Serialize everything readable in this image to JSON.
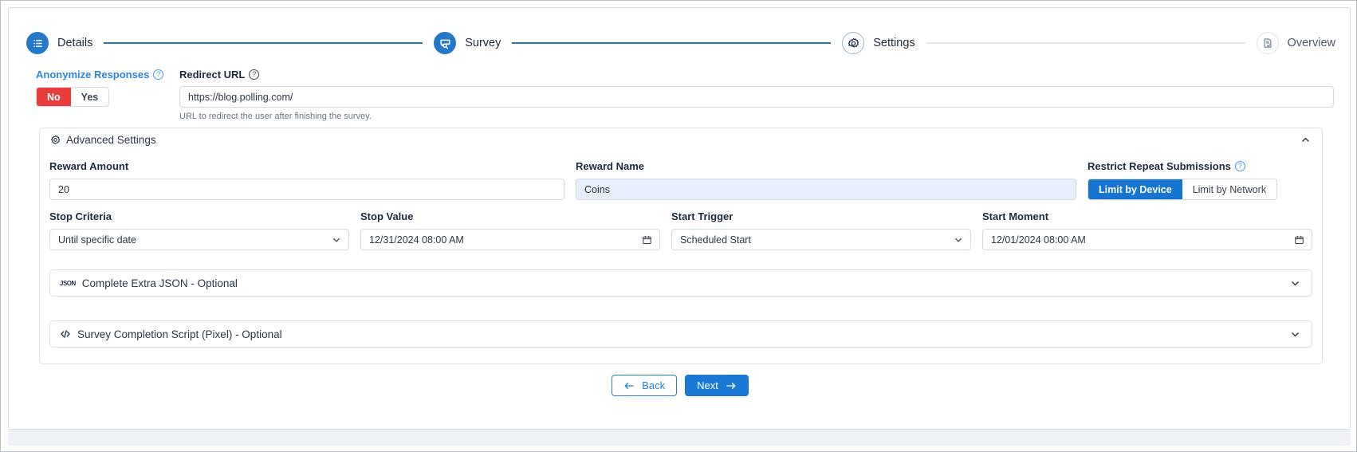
{
  "stepper": {
    "steps": [
      {
        "label": "Details",
        "icon": "list-icon",
        "state": "done"
      },
      {
        "label": "Survey",
        "icon": "survey-search-icon",
        "state": "done"
      },
      {
        "label": "Settings",
        "icon": "gear-icon",
        "state": "current"
      },
      {
        "label": "Overview",
        "icon": "document-check-icon",
        "state": "todo"
      }
    ]
  },
  "top": {
    "anonymize": {
      "label": "Anonymize Responses",
      "help_icon": "question-icon",
      "options": [
        "No",
        "Yes"
      ],
      "selected": "No"
    },
    "redirect": {
      "label": "Redirect URL",
      "help_icon": "question-icon",
      "value": "https://blog.polling.com/",
      "placeholder": "https://blog.polling.com/",
      "help_text": "URL to redirect the user after finishing the survey."
    }
  },
  "advanced": {
    "title": "Advanced Settings",
    "icon": "gear-icon",
    "chevron": "chevron-up-icon",
    "reward_amount": {
      "label": "Reward Amount",
      "value": "20",
      "placeholder": "Reward Amount"
    },
    "reward_name": {
      "label": "Reward Name",
      "value": "Coins",
      "placeholder": "Reward Name"
    },
    "restrict": {
      "label": "Restrict Repeat Submissions",
      "help_icon": "question-icon",
      "options": [
        "Limit by Device",
        "Limit by Network"
      ],
      "selected": "Limit by Device"
    },
    "stop_criteria": {
      "label": "Stop Criteria",
      "value": "Until specific date",
      "caret": "chevron-down-icon"
    },
    "stop_value": {
      "label": "Stop Value",
      "value": "12/31/2024 08:00 AM",
      "icon": "calendar-icon"
    },
    "start_trigger": {
      "label": "Start Trigger",
      "value": "Scheduled Start",
      "caret": "chevron-down-icon"
    },
    "start_moment": {
      "label": "Start Moment",
      "value": "12/01/2024 08:00 AM",
      "icon": "calendar-icon"
    },
    "panels": [
      {
        "label": "Complete Extra JSON - Optional",
        "icon": "json-icon",
        "chevron": "chevron-down-icon"
      },
      {
        "label": "Survey Completion Script (Pixel) - Optional",
        "icon": "code-icon",
        "chevron": "chevron-down-icon"
      }
    ]
  },
  "footer": {
    "back": {
      "label": "Back",
      "icon": "arrow-left-icon"
    },
    "next": {
      "label": "Next",
      "icon": "arrow-right-icon"
    }
  },
  "colors": {
    "accent_blue": "#1a79d4",
    "step_blue": "#2478c8",
    "danger_red": "#ea3c3c",
    "autofill_blue": "#e8eefb",
    "link_blue": "#2e86de"
  }
}
